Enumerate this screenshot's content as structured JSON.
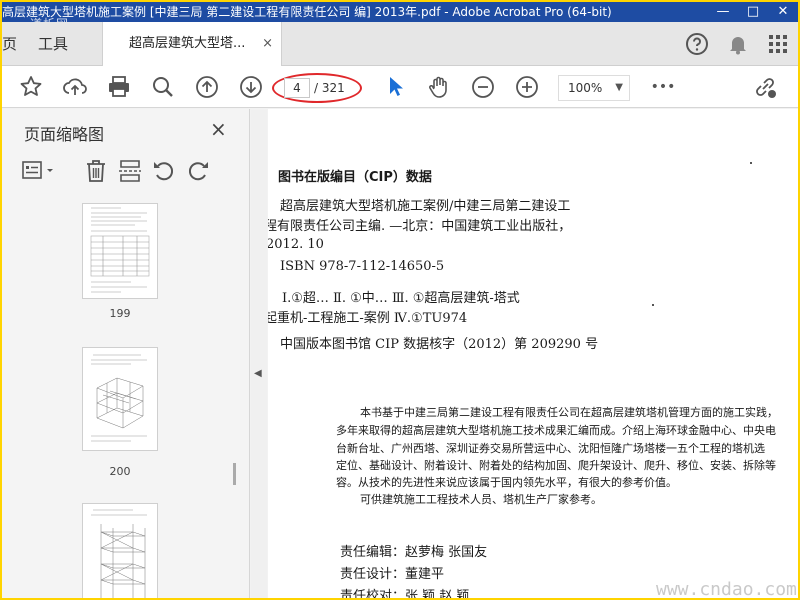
{
  "window": {
    "title": "高层建筑大型塔机施工案例 [中建三局 第二建设工程有限责任公司 编] 2013年.pdf - Adobe Acrobat Pro (64-bit)",
    "watermark": "道析网"
  },
  "tabs": {
    "home_partial": "页",
    "tools": "工具",
    "document": "超高层建筑大型塔...",
    "close": "×"
  },
  "toolbar": {
    "page_current": "4",
    "page_total": "/ 321",
    "zoom": "100%",
    "more": "•••"
  },
  "sidebar": {
    "title": "页面缩略图",
    "close": "×",
    "thumbnails": [
      {
        "label": "199"
      },
      {
        "label": "200"
      }
    ]
  },
  "document": {
    "cip_heading": "图书在版编目（CIP）数据",
    "lines": [
      "超高层建筑大型塔机施工案例/中建三局第二建设工",
      "程有限责任公司主编. —北京：中国建筑工业出版社，",
      "2012. 10",
      "ISBN 978-7-112-14650-5",
      "Ⅰ.①超…   Ⅱ. ①中…   Ⅲ. ①超高层建筑-塔式",
      "起重机-工程施工-案例   Ⅳ.①TU974",
      "中国版本图书馆 CIP 数据核字（2012）第 209290 号"
    ],
    "paragraph": [
      "本书基于中建三局第二建设工程有限责任公司在超高层建筑塔机管理方面的施工实践，",
      "多年来取得的超高层建筑大型塔机施工技术成果汇编而成。介绍上海环球金融中心、中央电",
      "台新台址、广州西塔、深圳证券交易所营运中心、沈阳恒隆广场塔楼一五个工程的塔机选",
      "定位、基础设计、附着设计、附着处的结构加固、爬升架设计、爬升、移位、安装、拆除等",
      "容。从技术的先进性来说应该属于国内领先水平，有很大的参考价值。",
      "可供建筑施工工程技术人员、塔机生产厂家参考。"
    ],
    "credits": [
      "责任编辑：赵萝梅   张国友",
      "责任设计：董建平",
      "责任校对：张   颖   赵   颖"
    ],
    "site_watermark": "www.cndao.com"
  }
}
